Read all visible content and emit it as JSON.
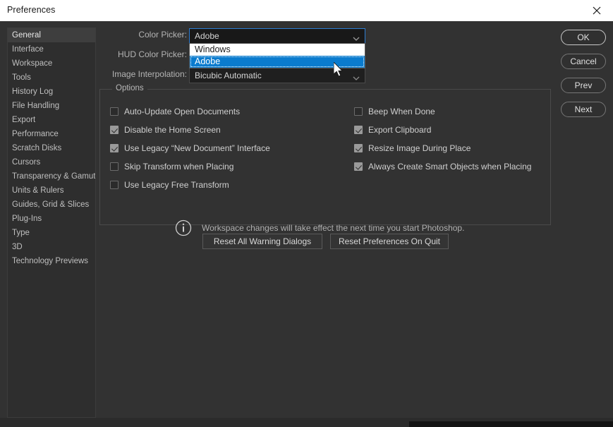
{
  "window": {
    "title": "Preferences",
    "close_icon": "close-icon"
  },
  "sidebar": {
    "items": [
      {
        "label": "General",
        "selected": true
      },
      {
        "label": "Interface",
        "selected": false
      },
      {
        "label": "Workspace",
        "selected": false
      },
      {
        "label": "Tools",
        "selected": false
      },
      {
        "label": "History Log",
        "selected": false
      },
      {
        "label": "File Handling",
        "selected": false
      },
      {
        "label": "Export",
        "selected": false
      },
      {
        "label": "Performance",
        "selected": false
      },
      {
        "label": "Scratch Disks",
        "selected": false
      },
      {
        "label": "Cursors",
        "selected": false
      },
      {
        "label": "Transparency & Gamut",
        "selected": false
      },
      {
        "label": "Units & Rulers",
        "selected": false
      },
      {
        "label": "Guides, Grid & Slices",
        "selected": false
      },
      {
        "label": "Plug-Ins",
        "selected": false
      },
      {
        "label": "Type",
        "selected": false
      },
      {
        "label": "3D",
        "selected": false
      },
      {
        "label": "Technology Previews",
        "selected": false
      }
    ]
  },
  "form": {
    "color_picker": {
      "label": "Color Picker:",
      "value": "Adobe",
      "expanded": true,
      "options": [
        "Windows",
        "Adobe"
      ],
      "highlighted_option": "Adobe"
    },
    "hud_color_picker": {
      "label": "HUD Color Picker:",
      "value": ""
    },
    "image_interpolation": {
      "label": "Image Interpolation:",
      "value": "Bicubic Automatic"
    }
  },
  "options": {
    "title": "Options",
    "left_column": [
      {
        "label": "Auto-Update Open Documents",
        "checked": false
      },
      {
        "label": "Disable the Home Screen",
        "checked": true
      },
      {
        "label": "Use Legacy “New Document” Interface",
        "checked": true
      },
      {
        "label": "Skip Transform when Placing",
        "checked": false
      },
      {
        "label": "Use Legacy Free Transform",
        "checked": false
      }
    ],
    "right_column": [
      {
        "label": "Beep When Done",
        "checked": false
      },
      {
        "label": "Export Clipboard",
        "checked": true
      },
      {
        "label": "Resize Image During Place",
        "checked": true
      },
      {
        "label": "Always Create Smart Objects when Placing",
        "checked": true
      }
    ]
  },
  "note": {
    "icon": "info-icon",
    "text": "Workspace changes will take effect the next time you start Photoshop."
  },
  "reset_buttons": [
    {
      "label": "Reset All Warning Dialogs"
    },
    {
      "label": "Reset Preferences On Quit"
    }
  ],
  "actions": [
    {
      "label": "OK",
      "primary": true
    },
    {
      "label": "Cancel",
      "primary": false
    },
    {
      "label": "Prev",
      "primary": false
    },
    {
      "label": "Next",
      "primary": false
    }
  ],
  "colors": {
    "dialog_bg": "#323232",
    "titlebar_bg": "#ffffff",
    "accent_highlight": "#0a7bce",
    "focus_border": "#2d7dd2",
    "text": "#cfcfcf"
  }
}
